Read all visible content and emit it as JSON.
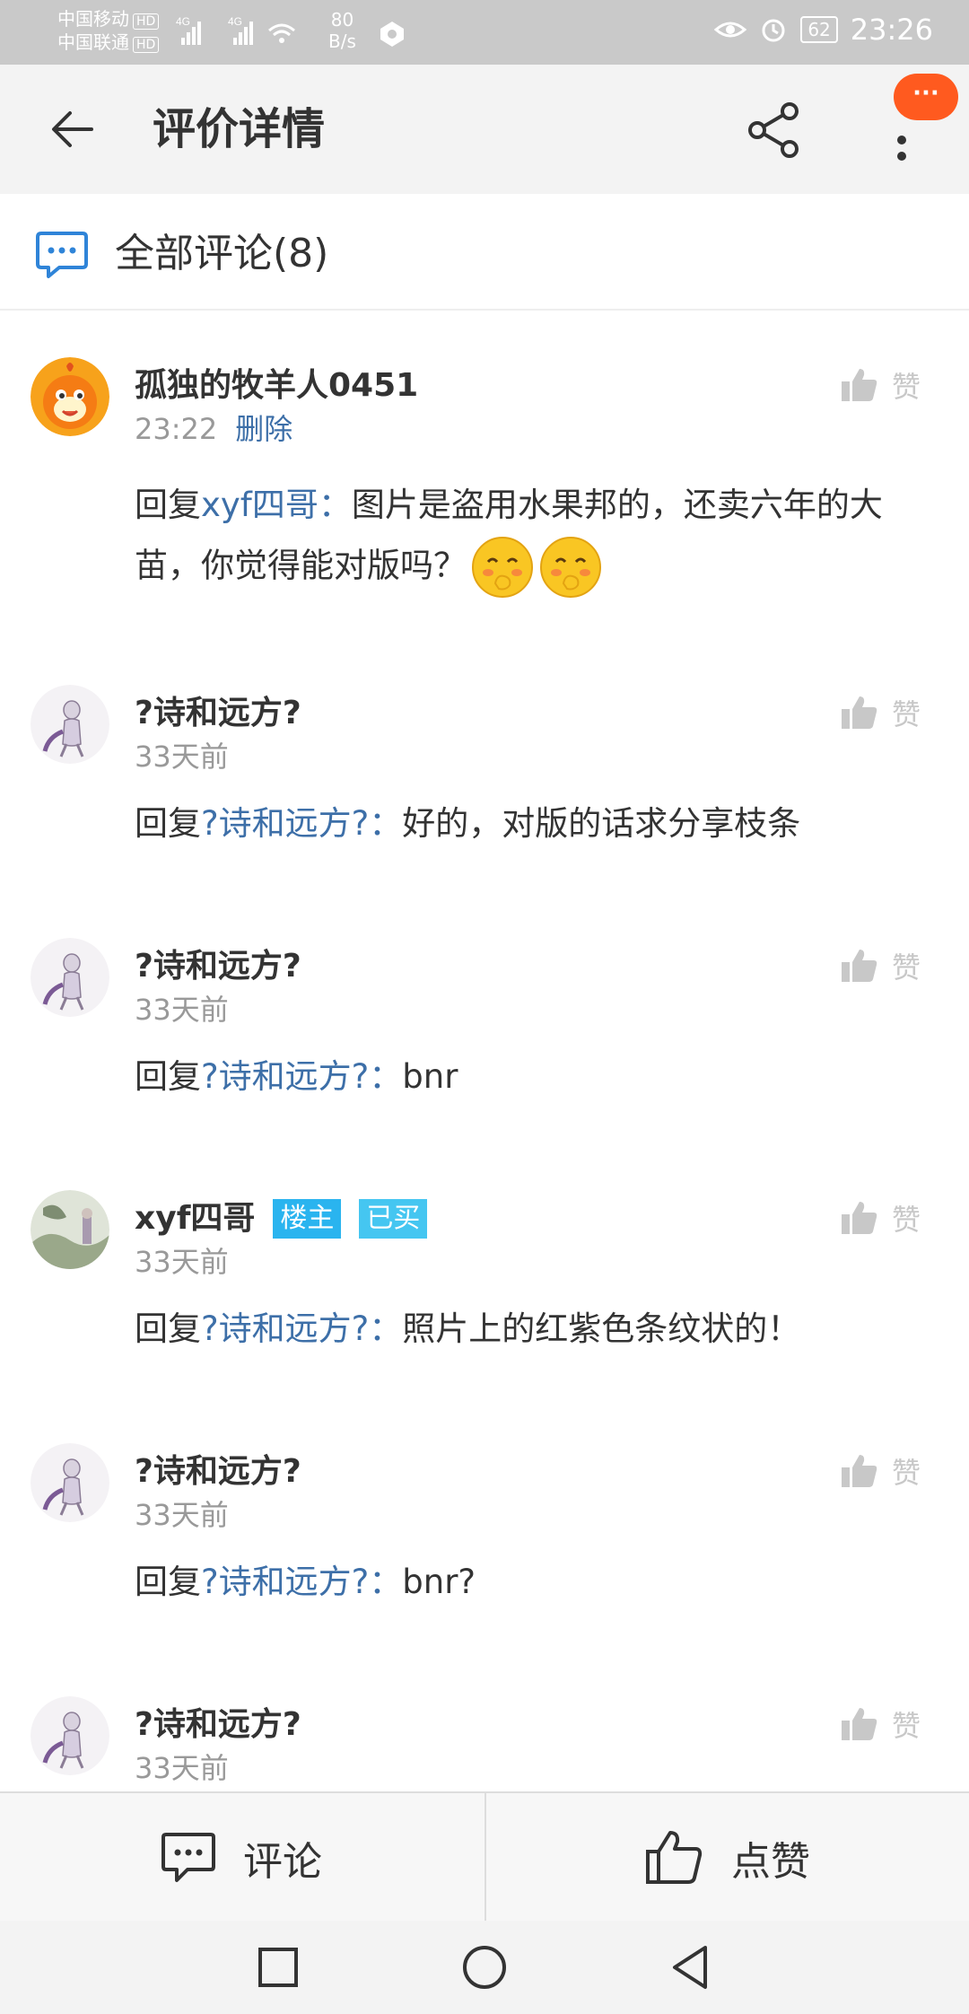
{
  "status_bar": {
    "carrier1": "中国移动",
    "carrier2": "中国联通",
    "hd": "HD",
    "net1": "4G",
    "net2": "4G",
    "speed_value": "80",
    "speed_unit": "B/s",
    "battery": "62",
    "time": "23:26"
  },
  "app_bar": {
    "title": "评价详情",
    "more_badge": "···"
  },
  "section": {
    "title": "全部评论(8)"
  },
  "comments": [
    {
      "name": "孤独的牧羊人0451",
      "time": "23:22",
      "delete": "删除",
      "like_label": "赞",
      "reply_prefix": "回复",
      "reply_target": "xyf四哥：",
      "text": "图片是盗用水果邦的，还卖六年的大苗，你觉得能对版吗？",
      "emoji_count": 2
    },
    {
      "name": "?诗和远方?",
      "time": "33天前",
      "like_label": "赞",
      "reply_prefix": "回复",
      "reply_target": "?诗和远方?：",
      "text": "好的，对版的话求分享枝条"
    },
    {
      "name": "?诗和远方?",
      "time": "33天前",
      "like_label": "赞",
      "reply_prefix": "回复",
      "reply_target": "?诗和远方?：",
      "text": "bnr"
    },
    {
      "name": "xyf四哥",
      "tag_owner": "楼主",
      "tag_bought": "已买",
      "time": "33天前",
      "like_label": "赞",
      "reply_prefix": "回复",
      "reply_target": "?诗和远方?：",
      "text": "照片上的红紫色条纹状的！"
    },
    {
      "name": "?诗和远方?",
      "time": "33天前",
      "like_label": "赞",
      "reply_prefix": "回复",
      "reply_target": "?诗和远方?：",
      "text": "bnr?"
    },
    {
      "name": "?诗和远方?",
      "time": "33天前",
      "like_label": "赞"
    }
  ],
  "bottom_bar": {
    "comment_label": "评论",
    "like_label": "点赞"
  },
  "colors": {
    "link_blue": "#3d6fa8",
    "badge_orange": "#ff5a1f",
    "tag_blue": "#2ab4ef"
  }
}
